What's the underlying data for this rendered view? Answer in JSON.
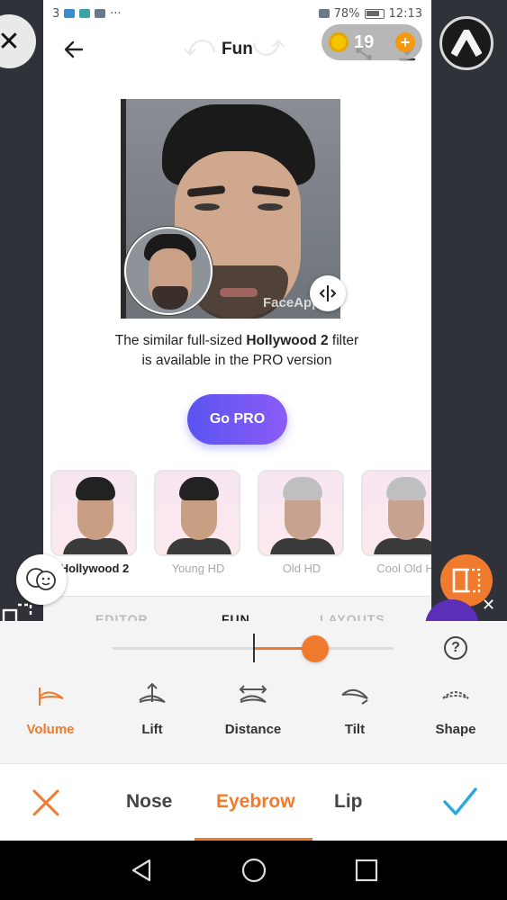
{
  "status_bar": {
    "left_text": "3",
    "battery": "78%",
    "time": "12:13"
  },
  "app_bar": {
    "title": "Fun",
    "back_icon": "arrow-left-icon",
    "undo_icon": "undo-icon",
    "redo_icon": "redo-icon",
    "share_icon": "share-icon",
    "download_icon": "download-icon"
  },
  "coins": {
    "count": "19",
    "add_label": "+"
  },
  "preview": {
    "watermark": "FaceApp"
  },
  "pro_message": {
    "line1_prefix": "The similar full-sized ",
    "filter_name": "Hollywood 2",
    "line1_suffix": " filter",
    "line2": "is available in the PRO version"
  },
  "go_pro_button": "Go PRO",
  "filters": [
    {
      "name": "Hollywood 2",
      "selected": true
    },
    {
      "name": "Young HD",
      "selected": false
    },
    {
      "name": "Old HD",
      "selected": false
    },
    {
      "name": "Cool Old H",
      "selected": false
    }
  ],
  "editor_tabs": [
    "EDITOR",
    "FUN",
    "LAYOUTS"
  ],
  "slider": {
    "value": 0.72
  },
  "tools": [
    {
      "label": "Volume",
      "active": true
    },
    {
      "label": "Lift",
      "active": false
    },
    {
      "label": "Distance",
      "active": false
    },
    {
      "label": "Tilt",
      "active": false
    },
    {
      "label": "Shape",
      "active": false
    }
  ],
  "categories": [
    {
      "label": "Nose",
      "active": false
    },
    {
      "label": "Eyebrow",
      "active": true
    },
    {
      "label": "Lip",
      "active": false
    }
  ],
  "colors": {
    "accent": "#f07b2e",
    "confirm": "#2aa7e0",
    "go_pro_start": "#5a54f0",
    "go_pro_end": "#8b5cf6"
  }
}
